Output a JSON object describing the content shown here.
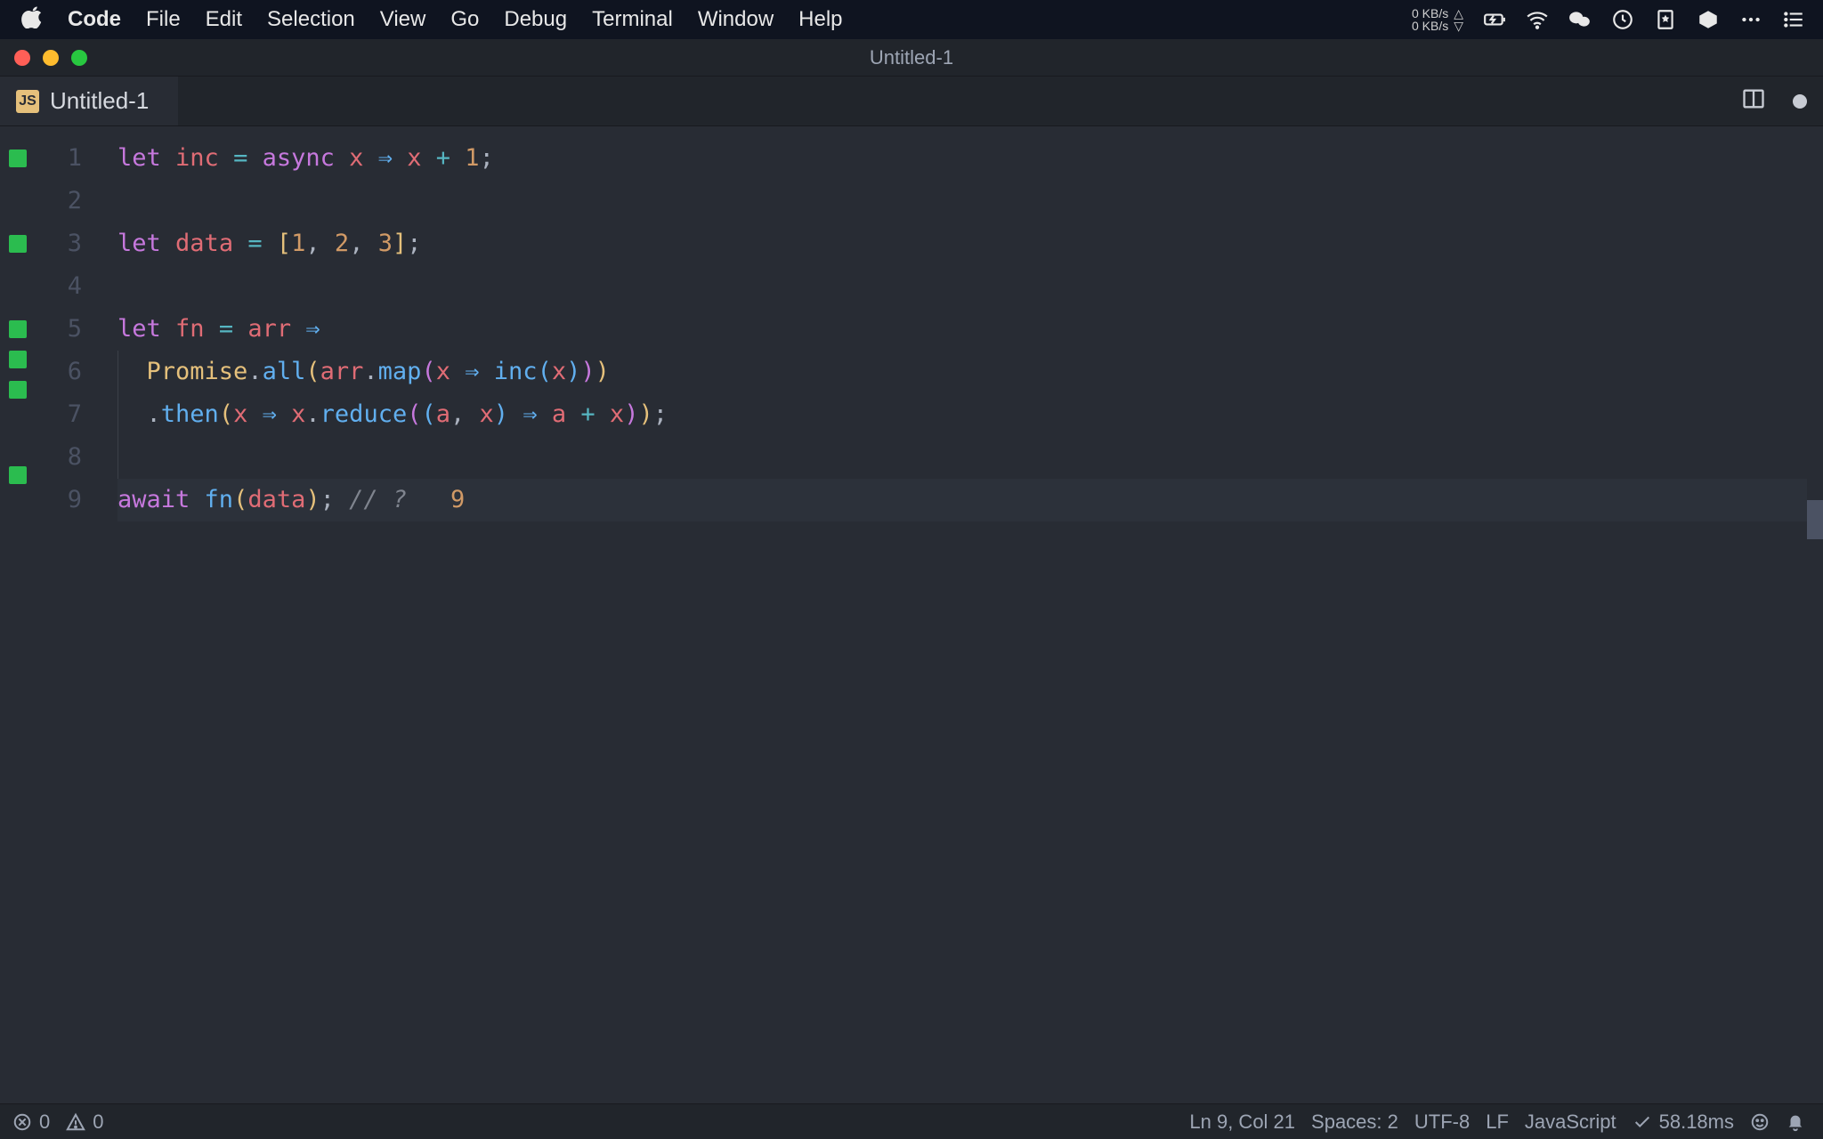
{
  "menubar": {
    "app_name": "Code",
    "items": [
      "File",
      "Edit",
      "Selection",
      "View",
      "Go",
      "Debug",
      "Terminal",
      "Window",
      "Help"
    ],
    "net_up": "0 KB/s",
    "net_down": "0 KB/s"
  },
  "window": {
    "title": "Untitled-1"
  },
  "tab": {
    "icon_text": "JS",
    "label": "Untitled-1"
  },
  "code": {
    "lines": [
      {
        "n": 1,
        "mark": true,
        "tokens": [
          {
            "t": "let",
            "c": "tk-kw"
          },
          {
            "t": " "
          },
          {
            "t": "inc",
            "c": "tk-var"
          },
          {
            "t": " "
          },
          {
            "t": "=",
            "c": "tk-op"
          },
          {
            "t": " "
          },
          {
            "t": "async",
            "c": "tk-kw"
          },
          {
            "t": " "
          },
          {
            "t": "x",
            "c": "tk-var"
          },
          {
            "t": " "
          },
          {
            "t": "⇒",
            "c": "tk-blue"
          },
          {
            "t": " "
          },
          {
            "t": "x",
            "c": "tk-var"
          },
          {
            "t": " "
          },
          {
            "t": "+",
            "c": "tk-op"
          },
          {
            "t": " "
          },
          {
            "t": "1",
            "c": "tk-num"
          },
          {
            "t": ";"
          }
        ]
      },
      {
        "n": 2,
        "mark": false,
        "tokens": []
      },
      {
        "n": 3,
        "mark": true,
        "tokens": [
          {
            "t": "let",
            "c": "tk-kw"
          },
          {
            "t": " "
          },
          {
            "t": "data",
            "c": "tk-var"
          },
          {
            "t": " "
          },
          {
            "t": "=",
            "c": "tk-op"
          },
          {
            "t": " "
          },
          {
            "t": "[",
            "c": "tk-yel"
          },
          {
            "t": "1",
            "c": "tk-num"
          },
          {
            "t": ", "
          },
          {
            "t": "2",
            "c": "tk-num"
          },
          {
            "t": ", "
          },
          {
            "t": "3",
            "c": "tk-num"
          },
          {
            "t": "]",
            "c": "tk-yel"
          },
          {
            "t": ";"
          }
        ]
      },
      {
        "n": 4,
        "mark": false,
        "tokens": []
      },
      {
        "n": 5,
        "mark": true,
        "tokens": [
          {
            "t": "let",
            "c": "tk-kw"
          },
          {
            "t": " "
          },
          {
            "t": "fn",
            "c": "tk-var"
          },
          {
            "t": " "
          },
          {
            "t": "=",
            "c": "tk-op"
          },
          {
            "t": " "
          },
          {
            "t": "arr",
            "c": "tk-var"
          },
          {
            "t": " "
          },
          {
            "t": "⇒",
            "c": "tk-blue"
          }
        ]
      },
      {
        "n": 6,
        "mark": true,
        "indent": 1,
        "tokens": [
          {
            "t": "  "
          },
          {
            "t": "Promise",
            "c": "tk-yel"
          },
          {
            "t": "."
          },
          {
            "t": "all",
            "c": "tk-blue"
          },
          {
            "t": "(",
            "c": "tk-yel"
          },
          {
            "t": "arr",
            "c": "tk-var"
          },
          {
            "t": "."
          },
          {
            "t": "map",
            "c": "tk-blue"
          },
          {
            "t": "(",
            "c": "tk-pur"
          },
          {
            "t": "x",
            "c": "tk-var"
          },
          {
            "t": " "
          },
          {
            "t": "⇒",
            "c": "tk-blue"
          },
          {
            "t": " "
          },
          {
            "t": "inc",
            "c": "tk-blue"
          },
          {
            "t": "(",
            "c": "tk-blue"
          },
          {
            "t": "x",
            "c": "tk-var"
          },
          {
            "t": ")",
            "c": "tk-blue"
          },
          {
            "t": ")",
            "c": "tk-pur"
          },
          {
            "t": ")",
            "c": "tk-yel"
          }
        ]
      },
      {
        "n": 7,
        "mark": true,
        "indent": 1,
        "tokens": [
          {
            "t": "  "
          },
          {
            "t": "."
          },
          {
            "t": "then",
            "c": "tk-blue"
          },
          {
            "t": "(",
            "c": "tk-yel"
          },
          {
            "t": "x",
            "c": "tk-var"
          },
          {
            "t": " "
          },
          {
            "t": "⇒",
            "c": "tk-blue"
          },
          {
            "t": " "
          },
          {
            "t": "x",
            "c": "tk-var"
          },
          {
            "t": "."
          },
          {
            "t": "reduce",
            "c": "tk-blue"
          },
          {
            "t": "(",
            "c": "tk-pur"
          },
          {
            "t": "(",
            "c": "tk-blue"
          },
          {
            "t": "a",
            "c": "tk-var"
          },
          {
            "t": ", "
          },
          {
            "t": "x",
            "c": "tk-var"
          },
          {
            "t": ")",
            "c": "tk-blue"
          },
          {
            "t": " "
          },
          {
            "t": "⇒",
            "c": "tk-blue"
          },
          {
            "t": " "
          },
          {
            "t": "a",
            "c": "tk-var"
          },
          {
            "t": " "
          },
          {
            "t": "+",
            "c": "tk-op"
          },
          {
            "t": " "
          },
          {
            "t": "x",
            "c": "tk-var"
          },
          {
            "t": ")",
            "c": "tk-pur"
          },
          {
            "t": ")",
            "c": "tk-yel"
          },
          {
            "t": ";"
          }
        ]
      },
      {
        "n": 8,
        "mark": false,
        "indent": 1,
        "tokens": []
      },
      {
        "n": 9,
        "mark": true,
        "current": true,
        "tokens": [
          {
            "t": "await",
            "c": "tk-kw"
          },
          {
            "t": " "
          },
          {
            "t": "fn",
            "c": "tk-blue"
          },
          {
            "t": "(",
            "c": "tk-yel"
          },
          {
            "t": "data",
            "c": "tk-var"
          },
          {
            "t": ")",
            "c": "tk-yel"
          },
          {
            "t": ";"
          },
          {
            "t": " "
          },
          {
            "t": "// ? ",
            "c": "tk-cmt"
          },
          {
            "t": "  "
          },
          {
            "t": "9",
            "c": "tk-num"
          }
        ]
      }
    ]
  },
  "statusbar": {
    "errors": "0",
    "warnings": "0",
    "position": "Ln 9, Col 21",
    "indent": "Spaces: 2",
    "encoding": "UTF-8",
    "eol": "LF",
    "language": "JavaScript",
    "timing": "58.18ms"
  }
}
